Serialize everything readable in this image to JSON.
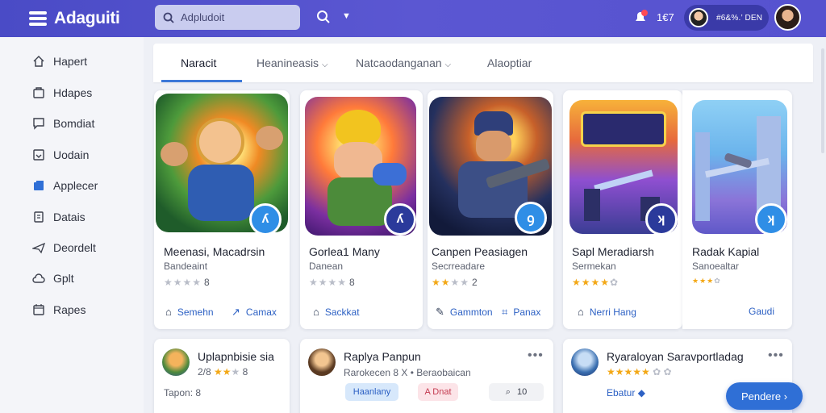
{
  "brand": {
    "name": "Adaguiti"
  },
  "search": {
    "placeholder": "Adpludoit"
  },
  "header": {
    "count": "1€7",
    "user_name": "#6&%.’ DEN"
  },
  "sidebar": {
    "items": [
      {
        "label": "Hapert",
        "icon": "home-icon"
      },
      {
        "label": "Hdapes",
        "icon": "folder-icon"
      },
      {
        "label": "Bomdiat",
        "icon": "chat-icon"
      },
      {
        "label": "Uodain",
        "icon": "download-icon"
      },
      {
        "label": "Applecer",
        "icon": "apps-icon"
      },
      {
        "label": "Datais",
        "icon": "document-icon"
      },
      {
        "label": "Deordelt",
        "icon": "plane-icon"
      },
      {
        "label": "Gplt",
        "icon": "cloud-icon"
      },
      {
        "label": "Rapes",
        "icon": "calendar-icon"
      }
    ]
  },
  "tabs": [
    {
      "label": "Naracit",
      "active": true
    },
    {
      "label": "Heanineasis",
      "chevron": true
    },
    {
      "label": "Natcaodanganan",
      "chevron": true
    },
    {
      "label": "Alaoptiar"
    }
  ],
  "cards": [
    {
      "title": "Meenasi, Macadrsin",
      "subtitle": "Bandeaint",
      "rating": "8",
      "stars_on": 0,
      "actions": [
        "Semehn",
        "Camax"
      ],
      "badge": "ʎ"
    },
    {
      "title": "Gorlea1 Many",
      "subtitle": "Danean",
      "rating": "8",
      "stars_on": 0,
      "actions": [
        "Sackkat"
      ],
      "badge": "ʎ"
    },
    {
      "title": "Canpen Peasiagen",
      "subtitle": "Secrreadare",
      "rating": "2",
      "stars_on": 2,
      "actions": [
        "Gammton",
        "Panax"
      ],
      "badge": "ꝯ"
    },
    {
      "title": "Sapl Meradiarsh",
      "subtitle": "Sermekan",
      "rating": "",
      "stars_on": 4,
      "actions": [
        "Nerri Hang"
      ],
      "badge": "ʞ"
    },
    {
      "title": "Radak Kapial",
      "subtitle": "Sanoealtar",
      "rating": "",
      "stars_on": 3,
      "actions": [
        "Gaudi"
      ],
      "badge": "ʞ"
    }
  ],
  "lower_cards": [
    {
      "title": "Uplapnbisie sia",
      "rating": "8",
      "stars_on": 2,
      "meta": "Tapon: 8",
      "line": "2/8"
    },
    {
      "title": "Raplya Panpun",
      "subtitle": "Rarokecen 8 X • Beraobaican",
      "pills": [
        "Haanlany",
        "A Dnat",
        "10"
      ]
    },
    {
      "title": "Ryaraloyan Saravportladag",
      "link": "Ebatur"
    }
  ],
  "cta": {
    "label": "Pendere"
  },
  "colors": {
    "accent": "#3c78d8",
    "header": "#4f4ecb",
    "star": "#f3a816"
  }
}
